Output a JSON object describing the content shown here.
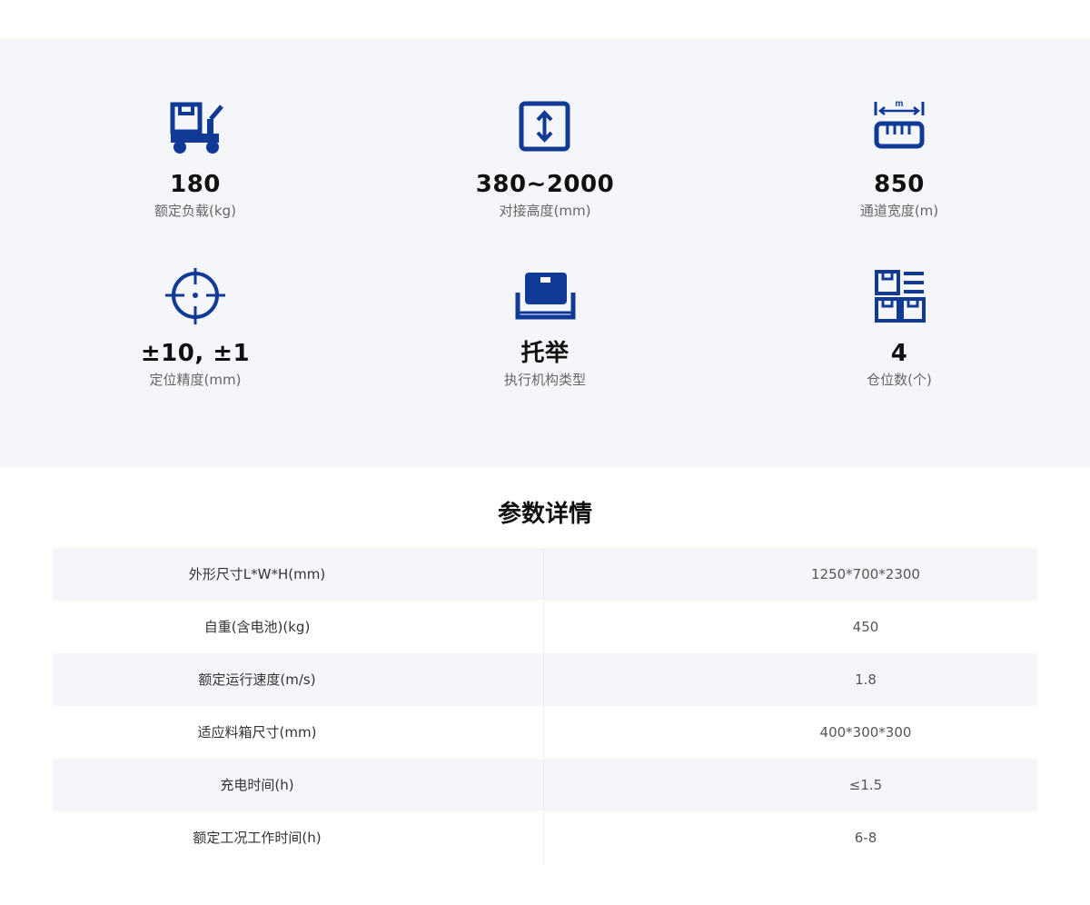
{
  "specs": [
    {
      "icon": "cart-box-icon",
      "value": "180",
      "label": "额定负载(kg)"
    },
    {
      "icon": "height-arrows-icon",
      "value": "380~2000",
      "label": "对接高度(mm)"
    },
    {
      "icon": "ruler-width-icon",
      "value": "850",
      "label": "通道宽度(m)",
      "icon_text": "m"
    },
    {
      "icon": "crosshair-icon",
      "value": "±10, ±1",
      "label": "定位精度(mm)"
    },
    {
      "icon": "lift-tray-icon",
      "value": "托举",
      "label": "执行机构类型"
    },
    {
      "icon": "storage-slots-icon",
      "value": "4",
      "label": "仓位数(个)"
    }
  ],
  "params": {
    "title": "参数详情",
    "rows": [
      {
        "name": "外形尺寸L*W*H(mm)",
        "value": "1250*700*2300"
      },
      {
        "name": "自重(含电池)(kg)",
        "value": "450"
      },
      {
        "name": "额定运行速度(m/s)",
        "value": "1.8"
      },
      {
        "name": "适应料箱尺寸(mm)",
        "value": "400*300*300"
      },
      {
        "name": "充电时间(h)",
        "value": "≤1.5"
      },
      {
        "name": "额定工况工作时间(h)",
        "value": "6-8"
      }
    ]
  },
  "colors": {
    "icon_blue": "#103a96",
    "panel_bg": "#f5f6fa",
    "row_shade": "#f5f6fa"
  }
}
